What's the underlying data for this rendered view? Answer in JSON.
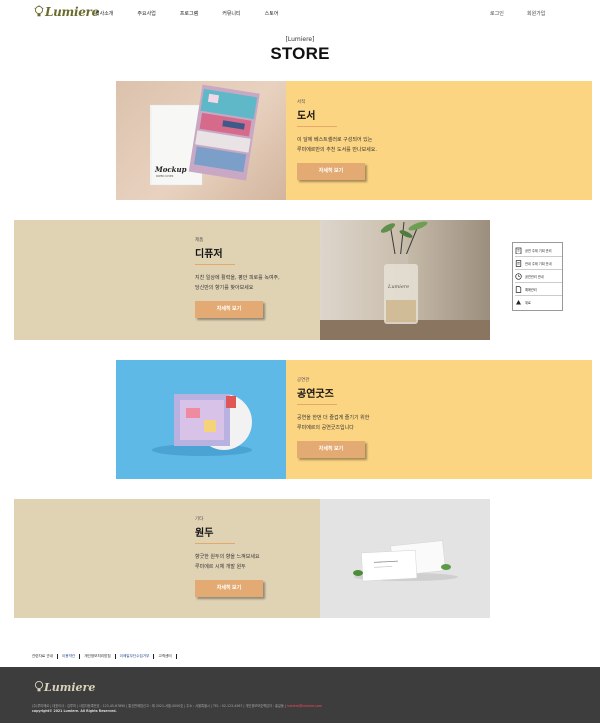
{
  "header": {
    "logo_text": "Lumiere",
    "nav": [
      "회사소개",
      "주요사업",
      "프로그램",
      "커뮤니티",
      "스토어"
    ],
    "login": "로그인",
    "signup": "회원가입"
  },
  "page": {
    "subtitle": "[Lumiere]",
    "title": "STORE"
  },
  "sections": [
    {
      "category": "서적",
      "title": "도서",
      "desc_line1": "이 달에 베스트셀러로 구성되어 있는",
      "desc_line2": "루미에르만의 추천 도서를 만나보세요.",
      "button": "자세히 보기",
      "image_label": "Mockup",
      "image_sublabel": "PAPER COVER"
    },
    {
      "category": "제품",
      "title": "디퓨저",
      "desc_line1": "지친 일상에 활력을, 평안 피로를 녹여주,",
      "desc_line2": "당신만의 향기를 찾아보세요",
      "button": "자세히 보기",
      "image_label": "Lumiere"
    },
    {
      "category": "공연관",
      "title": "공연굿즈",
      "desc_line1": "공연을 한번 더 즐겁게 즐기기 위한",
      "desc_line2": "루미에르의 공연굿즈입니다",
      "button": "자세히 보기"
    },
    {
      "category": "기타",
      "title": "원두",
      "desc_line1": "향긋한 원두의 향을 느껴보세요",
      "desc_line2": "루미에르 시체 개발 원두",
      "button": "자세히 보기"
    }
  ],
  "quick_menu": [
    {
      "icon": "building-icon",
      "label": "공연 주제 기획 관리"
    },
    {
      "icon": "document-icon",
      "label": "관내 주제 기획 안내"
    },
    {
      "icon": "clock-icon",
      "label": "공연관리 관내"
    },
    {
      "icon": "page-icon",
      "label": "예매관리"
    },
    {
      "icon": "up-arrow-icon",
      "label": "위로"
    }
  ],
  "footer": {
    "links": [
      {
        "label": "관련자료 관내",
        "blue": false
      },
      {
        "label": "이용약관",
        "blue": true
      },
      {
        "label": "개인정보처리방침",
        "blue": false
      },
      {
        "label": "이메일무단수집거부",
        "blue": true
      },
      {
        "label": "고객센터",
        "blue": false
      }
    ],
    "logo_text": "Lumiere",
    "info": "(주)루미에르 | 대표이사 : 김루미 | 사업자등록번호 : 123-45-67890 | 통신판매업신고 : 제 2021-서울-0000호 | 주소 : 서울특별시 | TEL : 02-123-4567 | 개인정보보호책임자 : 홍길동 |",
    "info_highlight": "lumiere@lumiere.com",
    "copyright": "copyright© 2021 Lumiere. All Rights Reserved."
  },
  "colors": {
    "yellow": "#fcd583",
    "beige": "#e0d3b4",
    "button": "#e3ab73",
    "footer": "#3d3d3d"
  }
}
